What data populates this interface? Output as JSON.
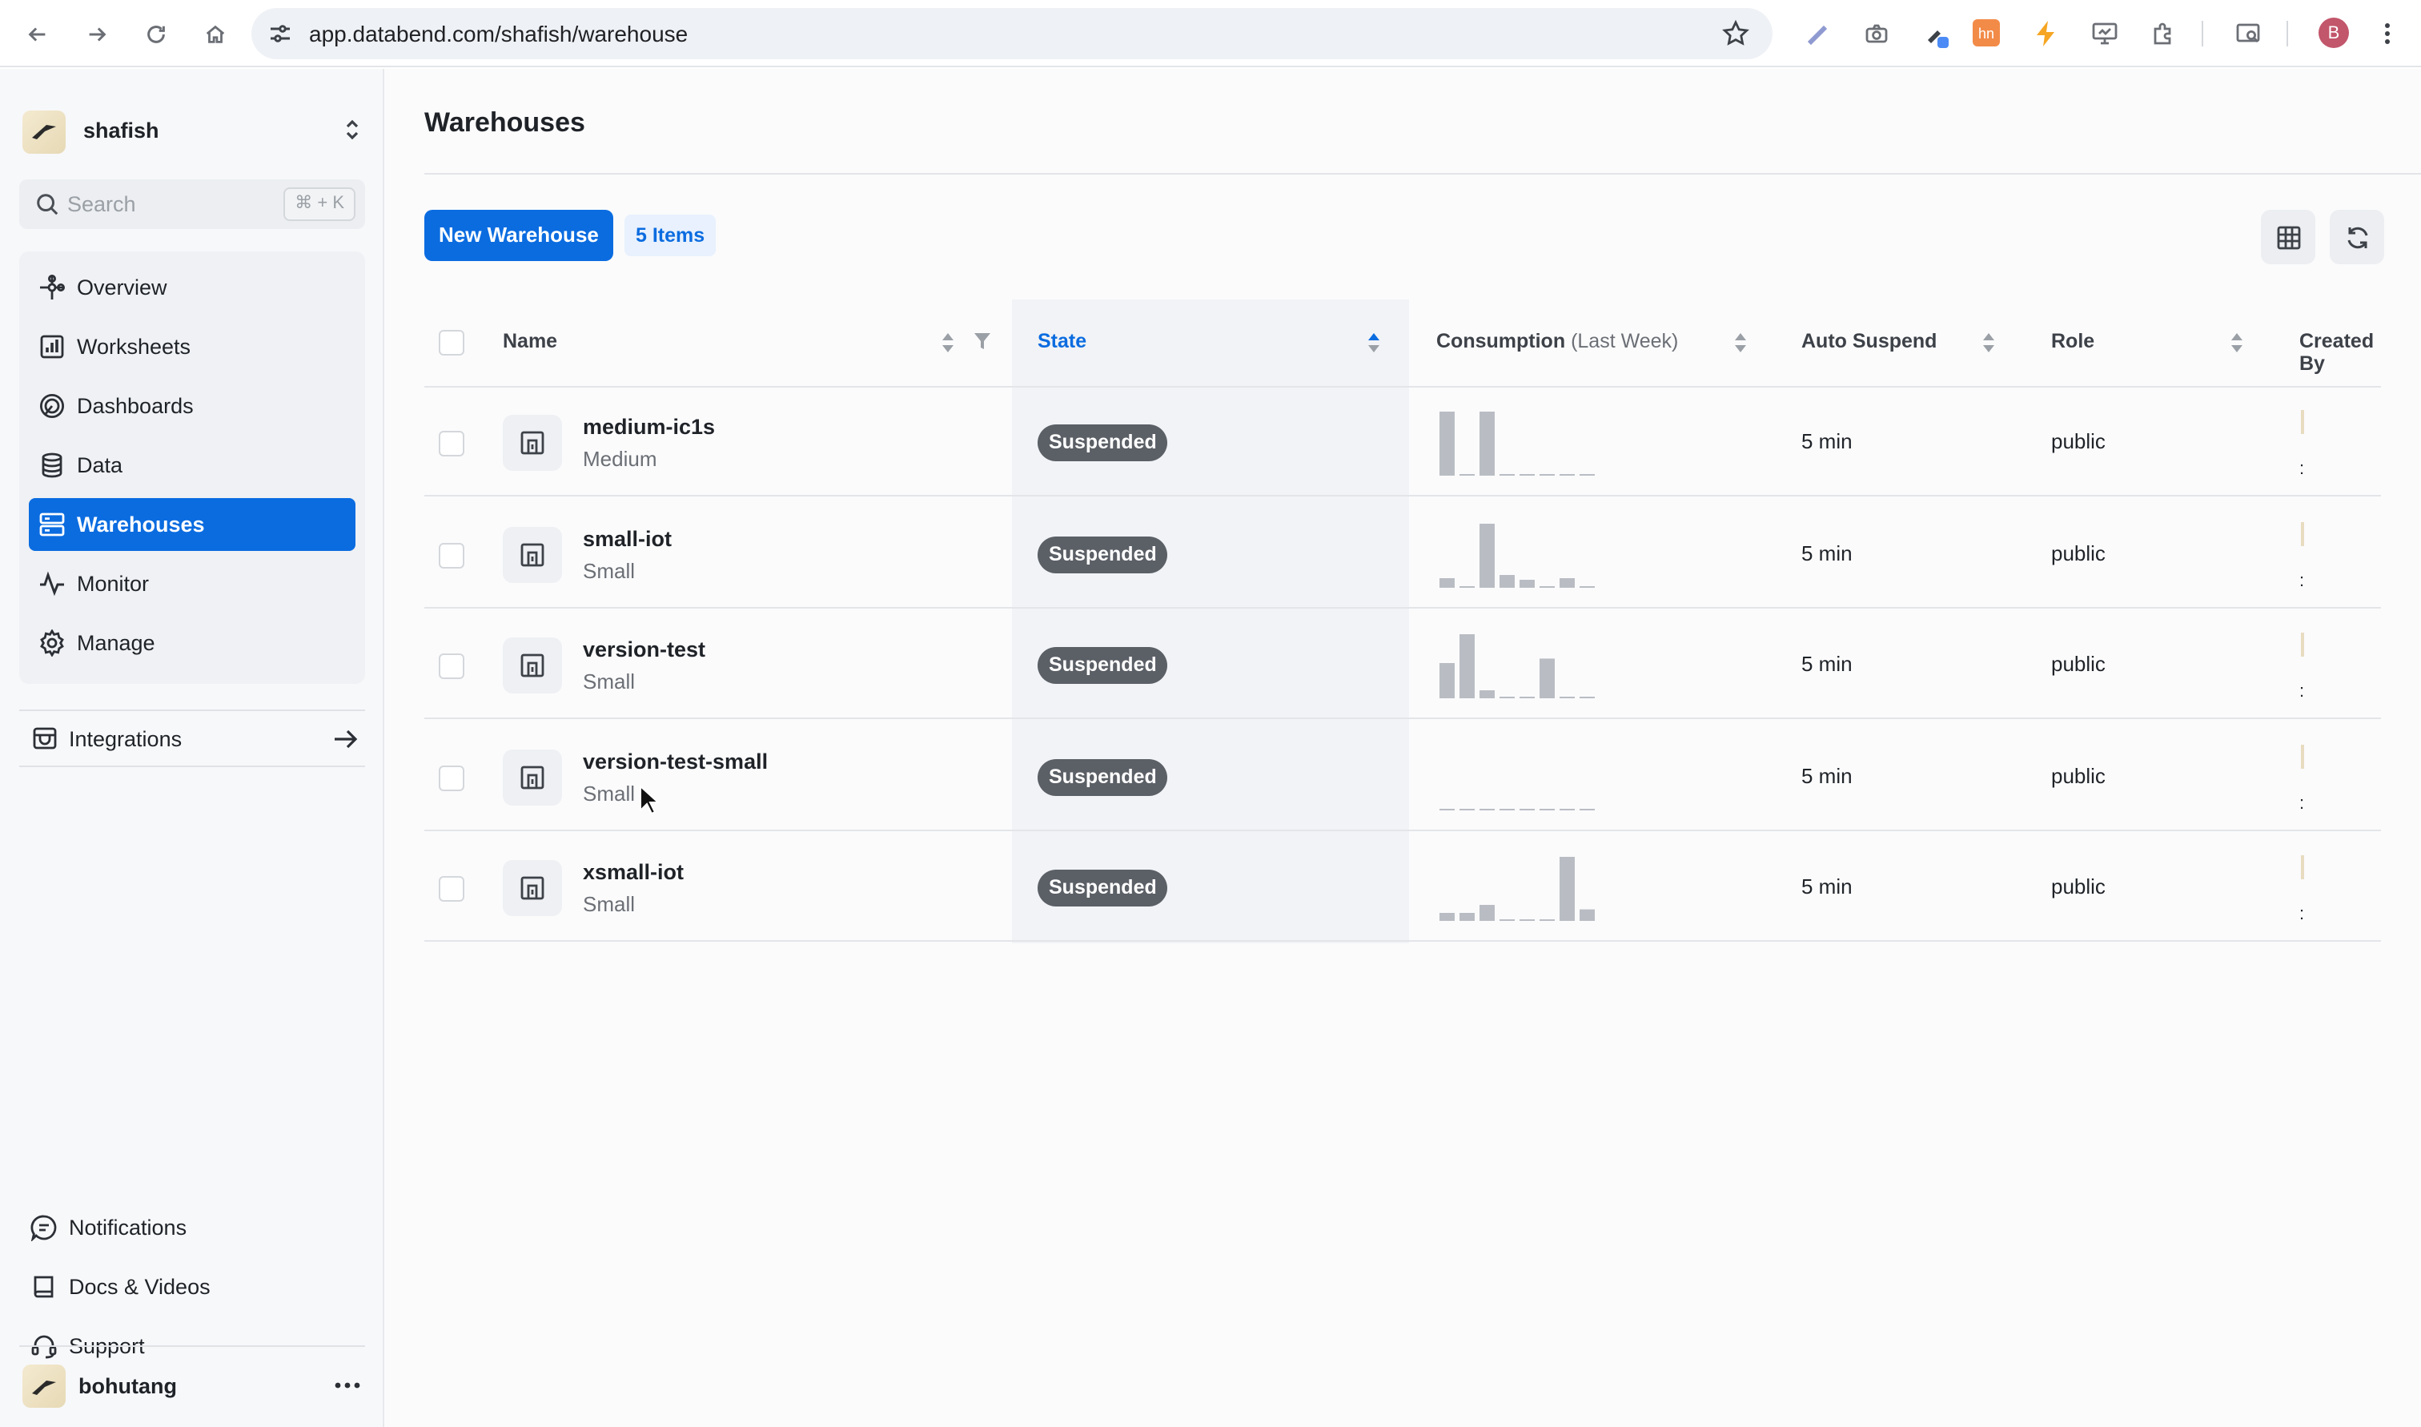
{
  "browser": {
    "url": "app.databend.com/shafish/warehouse",
    "profile_initial": "B",
    "hn_ext_label": "hn"
  },
  "sidebar": {
    "org_name": "shafish",
    "search": {
      "placeholder": "Search",
      "shortcut": "⌘ + K"
    },
    "items": [
      {
        "label": "Overview",
        "icon": "overview-icon",
        "active": false
      },
      {
        "label": "Worksheets",
        "icon": "worksheets-icon",
        "active": false
      },
      {
        "label": "Dashboards",
        "icon": "dashboards-icon",
        "active": false
      },
      {
        "label": "Data",
        "icon": "database-icon",
        "active": false
      },
      {
        "label": "Warehouses",
        "icon": "warehouses-icon",
        "active": true
      },
      {
        "label": "Monitor",
        "icon": "monitor-icon",
        "active": false
      },
      {
        "label": "Manage",
        "icon": "gear-icon",
        "active": false
      }
    ],
    "integrations": "Integrations",
    "footer": [
      {
        "label": "Notifications",
        "icon": "notifications-icon"
      },
      {
        "label": "Docs & Videos",
        "icon": "book-icon"
      },
      {
        "label": "Support",
        "icon": "headset-icon"
      }
    ],
    "user_name": "bohutang"
  },
  "main": {
    "title": "Warehouses",
    "new_button": "New Warehouse",
    "items_badge": "5 Items",
    "columns": {
      "name": "Name",
      "state": "State",
      "consumption": "Consumption",
      "consumption_sub": "(Last Week)",
      "auto_suspend": "Auto Suspend",
      "role": "Role",
      "created_by": "Created By"
    },
    "rows": [
      {
        "name": "medium-ic1s",
        "size": "Medium",
        "state": "Suspended",
        "auto_suspend": "5 min",
        "role": "public",
        "consumption": [
          1.0,
          0,
          1.0,
          0,
          0,
          0,
          0,
          0
        ]
      },
      {
        "name": "small-iot",
        "size": "Small",
        "state": "Suspended",
        "auto_suspend": "5 min",
        "role": "public",
        "consumption": [
          0.15,
          0,
          1.0,
          0.2,
          0.1,
          0,
          0.15,
          0
        ]
      },
      {
        "name": "version-test",
        "size": "Small",
        "state": "Suspended",
        "auto_suspend": "5 min",
        "role": "public",
        "consumption": [
          0.55,
          1.0,
          0.12,
          0,
          0,
          0.62,
          0,
          0
        ]
      },
      {
        "name": "version-test-small",
        "size": "Small",
        "state": "Suspended",
        "auto_suspend": "5 min",
        "role": "public",
        "consumption": [
          0,
          0,
          0,
          0,
          0,
          0,
          0,
          0
        ]
      },
      {
        "name": "xsmall-iot",
        "size": "Small",
        "state": "Suspended",
        "auto_suspend": "5 min",
        "role": "public",
        "consumption": [
          0.1,
          0.1,
          0.25,
          0,
          0,
          0,
          1.0,
          0.18
        ]
      }
    ]
  },
  "colors": {
    "accent": "#0b6ce0",
    "pill": "#5b5f66",
    "spark_bar": "#b9bdc3"
  }
}
